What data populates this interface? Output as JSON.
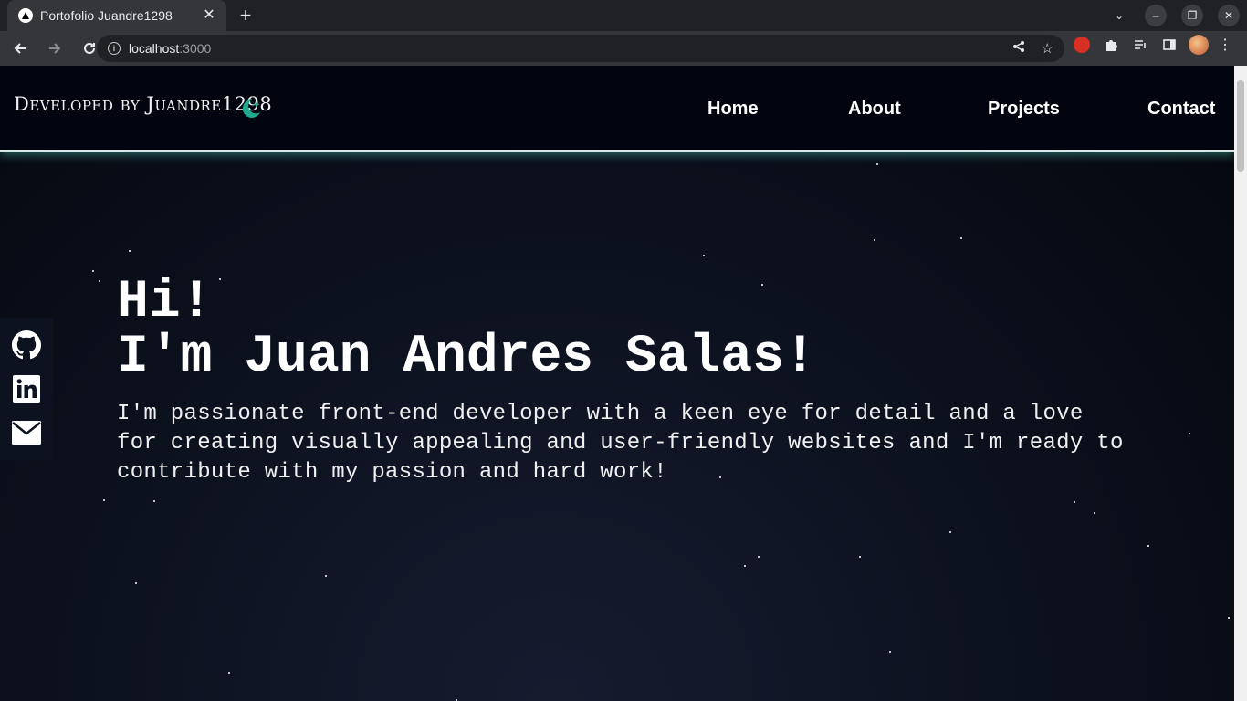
{
  "browser": {
    "tab_title": "Portofolio Juandre1298",
    "url_host": "localhost",
    "url_port": ":3000"
  },
  "site": {
    "brand": "Developed by Juandre1298",
    "nav": {
      "home": "Home",
      "about": "About",
      "projects": "Projects",
      "contact": "Contact"
    },
    "hero": {
      "line1": "Hi!",
      "line2": "I'm Juan Andres Salas!",
      "description": "I'm passionate front-end developer with a keen eye for detail and a love for creating visually appealing and user-friendly websites and I'm ready to contribute with my passion and hard work!"
    },
    "socials": [
      "github-icon",
      "linkedin-icon",
      "email-icon"
    ],
    "colors": {
      "accent": "#1fa98f",
      "header_bg": "#02050f",
      "page_bg": "#0d1220"
    }
  }
}
